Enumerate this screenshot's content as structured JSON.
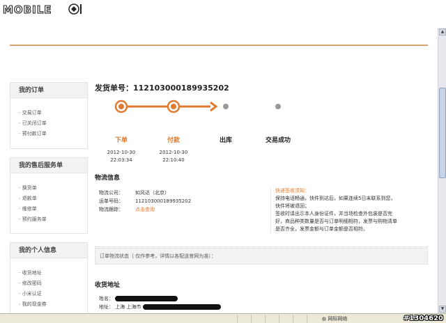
{
  "watermark": {
    "text": "MOBILE01"
  },
  "sidebar": {
    "sections": [
      {
        "title": "我的订单",
        "items": [
          "交易订单",
          "已关闭订单",
          "预付款订单"
        ]
      },
      {
        "title": "我的售后服务单",
        "items": [
          "换货单",
          "退款单",
          "维修单",
          "预约服务单"
        ]
      },
      {
        "title": "我的个人信息",
        "items": [
          "收货地址",
          "修改密码",
          "小米认证",
          "我的现金券"
        ]
      }
    ]
  },
  "main": {
    "order_label": "发货单号：",
    "order_number": "1121030001899352​02",
    "steps": [
      {
        "label": "下单",
        "date": "2012-10-30",
        "time": "22:03:34",
        "done": true
      },
      {
        "label": "付款",
        "date": "2012-10-30",
        "time": "22:10:40",
        "done": true
      },
      {
        "label": "出库",
        "date": "",
        "time": "",
        "done": false
      },
      {
        "label": "交易成功",
        "date": "",
        "time": "",
        "done": false
      }
    ],
    "colors": {
      "accent": "#e07a2e",
      "pending": "#999999"
    },
    "logistics": {
      "title": "物流信息",
      "company_key": "物流公司：",
      "company_val": "如风达（北京）",
      "waybill_key": "运单号码：",
      "waybill_val": "112103000189935202",
      "track_key": "物流跟踪：",
      "track_link": "点击查询"
    },
    "notice": {
      "title": "快递签收须知：",
      "lines": [
        "保持电话畅通，快件到达后，如果连续5日未联系到您，",
        "快件将被退回；",
        "签收时请出示本人身份证件，并当场检查外包装是否完",
        "好，商品种类数量是否与订单明细相符，发票与购物清单",
        "是否齐全，发票金额与订单金额是否相符。"
      ]
    },
    "status_note": "订单物流状态（ 仅作参考，详情以各配送官网为准）：",
    "address": {
      "title": "收货地址",
      "name_key": "姓名：",
      "addr_key": "地址：",
      "addr_val": "上海  上海市"
    }
  },
  "statusbar": {
    "zone": "网际网络",
    "tag": "#1304620"
  }
}
